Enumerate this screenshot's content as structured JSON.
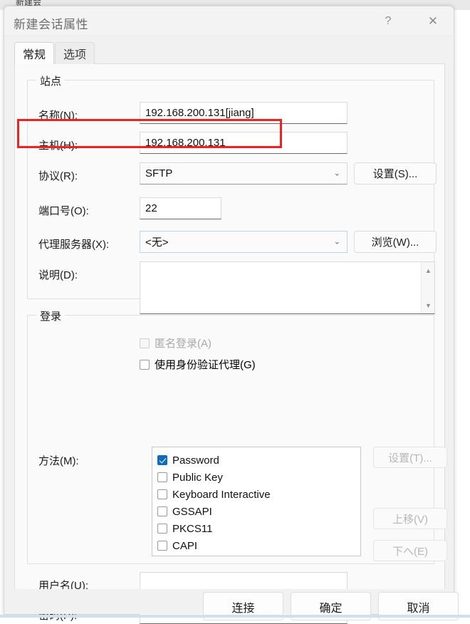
{
  "background_window": {
    "partial_text": "新建会"
  },
  "dialog": {
    "title": "新建会话属性",
    "help_icon": "?",
    "close_icon": "✕",
    "tabs": [
      {
        "label": "常规",
        "selected": true
      },
      {
        "label": "选项",
        "selected": false
      }
    ]
  },
  "site_group": {
    "legend": "站点",
    "name_label": "名称(N):",
    "name_value": "192.168.200.131[jiang]",
    "host_label": "主机(H):",
    "host_value": "192.168.200.131",
    "protocol_label": "协议(R):",
    "protocol_value": "SFTP",
    "protocol_button": "设置(S)...",
    "port_label": "端口号(O):",
    "port_value": "22",
    "spin_up_icon": "▲",
    "spin_down_icon": "▼",
    "proxy_label": "代理服务器(X):",
    "proxy_value": "<无>",
    "proxy_button": "浏览(W)...",
    "desc_label": "说明(D):",
    "desc_value": "",
    "desc_scroll_up": "▲",
    "desc_scroll_down": "▼",
    "dropdown_arrow": "⌄"
  },
  "login_group": {
    "legend": "登录",
    "anonymous_label": "匿名登录(A)",
    "anonymous_checked": false,
    "anonymous_disabled": true,
    "agent_label": "使用身份验证代理(G)",
    "agent_checked": false,
    "method_label": "方法(M):",
    "methods": [
      {
        "label": "Password",
        "checked": true
      },
      {
        "label": "Public Key",
        "checked": false
      },
      {
        "label": "Keyboard Interactive",
        "checked": false
      },
      {
        "label": "GSSAPI",
        "checked": false
      },
      {
        "label": "PKCS11",
        "checked": false
      },
      {
        "label": "CAPI",
        "checked": false
      }
    ],
    "method_settings_button": "设置(T)...",
    "move_up_button": "上移(V)",
    "move_down_button": "下へ(E)",
    "username_label": "用户名(U):",
    "username_value": "",
    "password_label": "密码(P):",
    "password_value": ""
  },
  "footer": {
    "connect": "连接",
    "ok": "确定",
    "cancel": "取消"
  },
  "annotation": {
    "color": "#ee2222",
    "target": "host-field-row"
  }
}
